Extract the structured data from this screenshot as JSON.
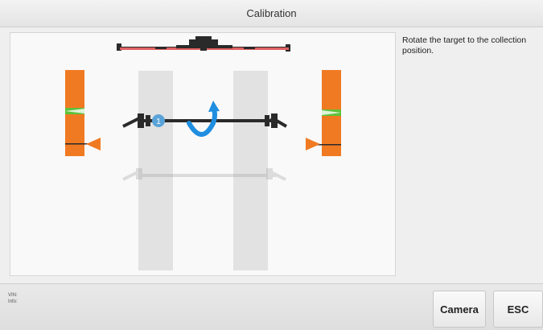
{
  "window": {
    "title": "Calibration"
  },
  "instruction": {
    "text": "Rotate the target to the collection position."
  },
  "info": {
    "vin_label": "VIN:",
    "info_label": "Info:"
  },
  "buttons": {
    "camera": "Camera",
    "esc": "ESC"
  },
  "markers": {
    "current_position": "1"
  },
  "colors": {
    "target_orange": "#f07a22",
    "target_green": "#5cc23a",
    "bar_red": "#e06060",
    "axle": "#2a2a2a",
    "arrow_blue": "#1f8ee0",
    "marker_blue": "#5aa3d9",
    "track_gray": "#e2e2e2"
  }
}
